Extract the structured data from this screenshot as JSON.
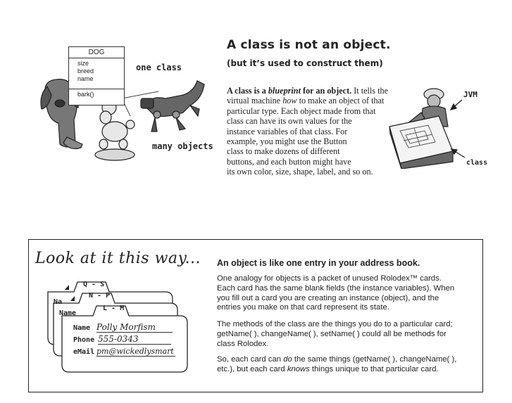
{
  "top": {
    "uml": {
      "title": "DOG",
      "attributes": [
        "size",
        "breed",
        "name"
      ],
      "methods": [
        "bark()"
      ]
    },
    "label_one_class": "one class",
    "label_many_objects": "many objects",
    "heading": "A class is not an object.",
    "subheading": "(but it’s used to construct them)",
    "paragraph_lines": [
      {
        "bold1": "A class is a ",
        "italic1": "blueprint",
        "bold2": " for an object.",
        "rest": " It tells the"
      },
      {
        "pre": "virtual machine ",
        "italic": "how",
        "post": " to make an object of that"
      },
      {
        "text": "particular type. Each object made from that"
      },
      {
        "text": "class can have its own values for the"
      },
      {
        "text": "instance variables of that class.  For"
      },
      {
        "text": "example, you might use the Button"
      },
      {
        "text": "class to make dozens of different"
      },
      {
        "text": "buttons, and each button might have"
      },
      {
        "text": "its own color, size, shape, label, and so on."
      }
    ],
    "label_jvm": "JVM",
    "label_class": "class"
  },
  "bottom": {
    "look_title": "Look at it this way...",
    "cards": {
      "tab_back": "Q - S",
      "tab_middle": "N - P",
      "tab_front": "L - M",
      "peek_back": "Na",
      "peek_middle": "Name",
      "label_name": "Name",
      "label_phone": "Phone",
      "label_email": "eMail",
      "value_name": "Polly Morfism",
      "value_phone": "555-0343",
      "value_email": "pm@wickedlysmart"
    },
    "object_heading": "An object is like one entry in your address book.",
    "p1_lines": [
      "One analogy for objects is a packet of unused Rolodex™ cards.",
      "Each card has the same blank fields (the instance variables). When",
      "you fill out a card you are creating an instance (object), and the",
      "entries you make on that card represent its state."
    ],
    "p2_lines": [
      "The methods of the class are the things you do to a particular card;",
      "getName( ), changeName( ), setName( ) could all be methods for",
      "class Rolodex."
    ],
    "p3": {
      "l1_pre": "So, each card can ",
      "l1_em": "do",
      "l1_post": " the same things (getName( ), changeName( ),",
      "l2_pre": "etc.), but each card ",
      "l2_em": "knows",
      "l2_post": " things unique to that particular card."
    }
  }
}
